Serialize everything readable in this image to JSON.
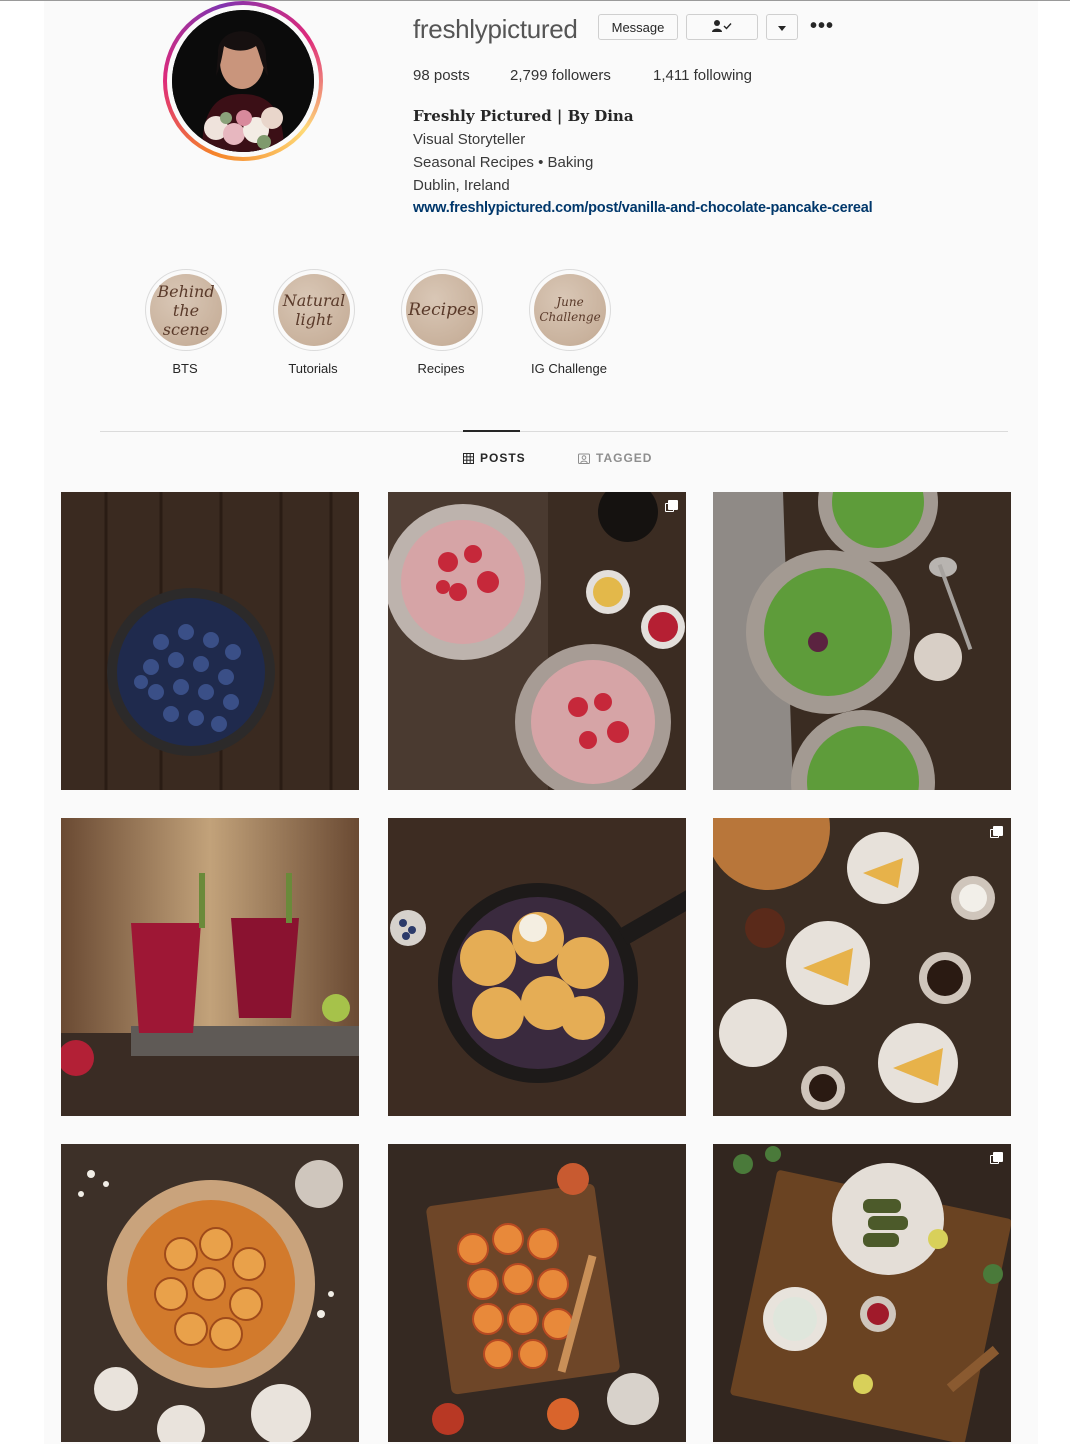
{
  "profile": {
    "username": "freshlypictured",
    "buttons": {
      "message": "Message",
      "follow_icon": "person-check-icon",
      "dropdown_icon": "chevron-down-icon",
      "more": "•••"
    },
    "stats": {
      "posts": "98 posts",
      "followers": "2,799 followers",
      "following": "1,411 following"
    },
    "full_name": "Freshly Pictured | By Dina",
    "bio": [
      "Visual Storyteller",
      "Seasonal Recipes • Baking",
      "Dublin, Ireland"
    ],
    "link": "www.freshlypictured.com/post/vanilla-and-chocolate-pancake-cereal",
    "ring_colors": [
      "#f58529",
      "#dd2a7b",
      "#8134af"
    ]
  },
  "highlights": [
    {
      "label": "BTS",
      "cover": "Behind the scene"
    },
    {
      "label": "Tutorials",
      "cover": "Natural light"
    },
    {
      "label": "Recipes",
      "cover": "Recipes"
    },
    {
      "label": "IG Challenge",
      "cover": "June Challenge"
    }
  ],
  "tabs": [
    {
      "label": "POSTS",
      "icon": "grid-icon",
      "active": true
    },
    {
      "label": "TAGGED",
      "icon": "tag-user-icon",
      "active": false
    }
  ],
  "posts": [
    {
      "subject": "blueberries-bowl",
      "multiple": false
    },
    {
      "subject": "strawberry-porridge",
      "multiple": true
    },
    {
      "subject": "green-soup",
      "multiple": false
    },
    {
      "subject": "berry-drinks",
      "multiple": false
    },
    {
      "subject": "blueberry-cobbler",
      "multiple": false
    },
    {
      "subject": "orange-cake-slices",
      "multiple": true
    },
    {
      "subject": "orange-upside-down-cake",
      "multiple": false
    },
    {
      "subject": "blood-orange-slices",
      "multiple": false
    },
    {
      "subject": "stuffed-vine-leaves-tray",
      "multiple": true
    }
  ]
}
